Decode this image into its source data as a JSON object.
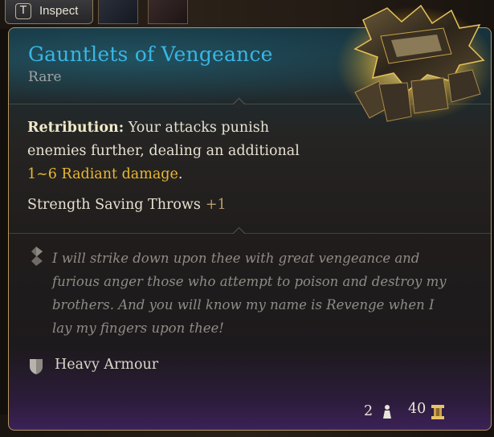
{
  "topbar": {
    "inspect_key": "T",
    "inspect_label": "Inspect"
  },
  "item": {
    "name": "Gauntlets of Vengeance",
    "rarity": "Rare",
    "ability_name": "Retribution:",
    "ability_text_before": " Your attacks punish enemies further, dealing an additional ",
    "ability_damage": "1~6 Radiant damage",
    "ability_text_after": ".",
    "stat_label": "Strength Saving Throws",
    "stat_bonus": "+1",
    "flavor_text": "I will strike down upon thee with great vengeance and furious anger those who attempt to poison and destroy my brothers. And you will know my name is Revenge when I lay my fingers upon thee!",
    "armour_type": "Heavy Armour",
    "armour_icon": "shield-icon",
    "weight": "2",
    "weight_icon": "weight-icon",
    "value": "40",
    "value_icon": "gold-icon"
  },
  "colors": {
    "name": "#38b6e4",
    "rarity": "#a3a3a0",
    "damage": "#e9b833",
    "bonus": "#b99c6d",
    "flavor": "#8f8b86",
    "border": "#b6965e"
  }
}
